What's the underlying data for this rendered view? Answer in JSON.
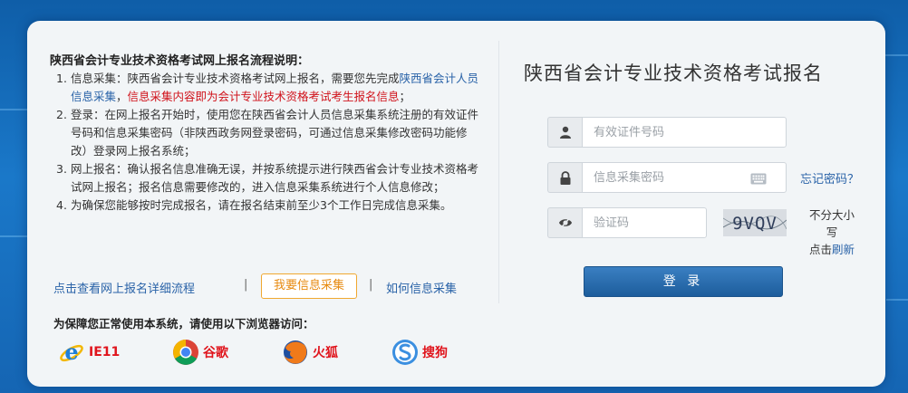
{
  "guide": {
    "title": "陕西省会计专业技术资格考试网上报名流程说明：",
    "steps": [
      {
        "num": "1.",
        "parts": [
          {
            "text": "信息采集：陕西省会计专业技术资格考试网上报名，需要您先完成",
            "style": "plain"
          },
          {
            "text": "陕西省会计人员信息采集",
            "style": "blue"
          },
          {
            "text": "，",
            "style": "plain"
          },
          {
            "text": "信息采集内容即为会计专业技术资格考试考生报名信息",
            "style": "red"
          },
          {
            "text": "；",
            "style": "plain"
          }
        ]
      },
      {
        "num": "2.",
        "parts": [
          {
            "text": "登录：在网上报名开始时，使用您在陕西省会计人员信息采集系统注册的有效证件号码和信息采集密码（非陕西政务网登录密码，可通过信息采集修改密码功能修改）登录网上报名系统；",
            "style": "plain"
          }
        ]
      },
      {
        "num": "3.",
        "parts": [
          {
            "text": "网上报名：确认报名信息准确无误，并按系统提示进行陕西省会计专业技术资格考试网上报名；报名信息需要修改的，进入信息采集系统进行个人信息修改；",
            "style": "plain"
          }
        ]
      },
      {
        "num": "4.",
        "parts": [
          {
            "text": "为确保您能够按时完成报名，请在报名结束前至少3个工作日完成信息采集。",
            "style": "plain"
          }
        ]
      }
    ]
  },
  "links": {
    "view_flow": "点击查看网上报名详细流程",
    "separator": "|",
    "collect": "我要信息采集",
    "how_collect": "如何信息采集"
  },
  "browsers": {
    "title": "为保障您正常使用本系统，请使用以下浏览器访问：",
    "items": [
      {
        "label": "IE11",
        "icon": "ie-icon"
      },
      {
        "label": "谷歌",
        "icon": "chrome-icon"
      },
      {
        "label": "火狐",
        "icon": "firefox-icon"
      },
      {
        "label": "搜狗",
        "icon": "sogou-icon"
      }
    ]
  },
  "login": {
    "title": "陕西省会计专业技术资格考试报名",
    "id_placeholder": "有效证件号码",
    "password_placeholder": "信息采集密码",
    "forgot": "忘记密码？",
    "captcha_placeholder": "验证码",
    "captcha_text": "9VQV",
    "captcha_hint": "不分大小写",
    "captcha_refresh_prefix": "点击",
    "captcha_refresh": "刷新",
    "submit": "登 录"
  },
  "colors": {
    "accent_blue": "#2a63a8",
    "warning_red": "#d0121b",
    "orange": "#e78a10",
    "login_button": "#1d5d9c"
  }
}
